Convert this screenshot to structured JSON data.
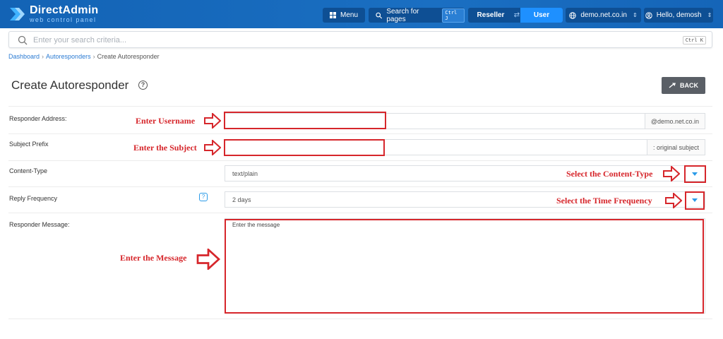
{
  "brand": {
    "title": "DirectAdmin",
    "subtitle": "web control panel",
    "accent": "#1a6fc2"
  },
  "topbar": {
    "menu_label": "Menu",
    "search_label": "Search for pages",
    "search_kbd": "Ctrl J",
    "role_reseller": "Reseller",
    "role_user": "User",
    "domain_label": "demo.net.co.in",
    "hello_label": "Hello, demosh"
  },
  "search": {
    "placeholder": "Enter your search criteria...",
    "kbd": "Ctrl K"
  },
  "breadcrumb": {
    "items": [
      "Dashboard",
      "Autoresponders",
      "Create Autoresponder"
    ]
  },
  "page": {
    "title": "Create Autoresponder",
    "help_glyph": "?",
    "back_label": "BACK"
  },
  "form": {
    "responder_address": {
      "label": "Responder Address:",
      "value": "",
      "suffix": "@demo.net.co.in"
    },
    "subject_prefix": {
      "label": "Subject Prefix",
      "value": "",
      "suffix": ": original subject"
    },
    "content_type": {
      "label": "Content-Type",
      "value": "text/plain"
    },
    "reply_frequency": {
      "label": "Reply Frequency",
      "value": "2 days",
      "help_glyph": "?"
    },
    "responder_message": {
      "label": "Responder Message:",
      "value": "Enter the message"
    }
  },
  "annotations": {
    "color": "#d6262b",
    "username": "Enter Username",
    "subject": "Enter the Subject",
    "content_type": "Select the Content-Type",
    "time_frequency": "Select the Time Frequency",
    "message": "Enter the Message"
  }
}
